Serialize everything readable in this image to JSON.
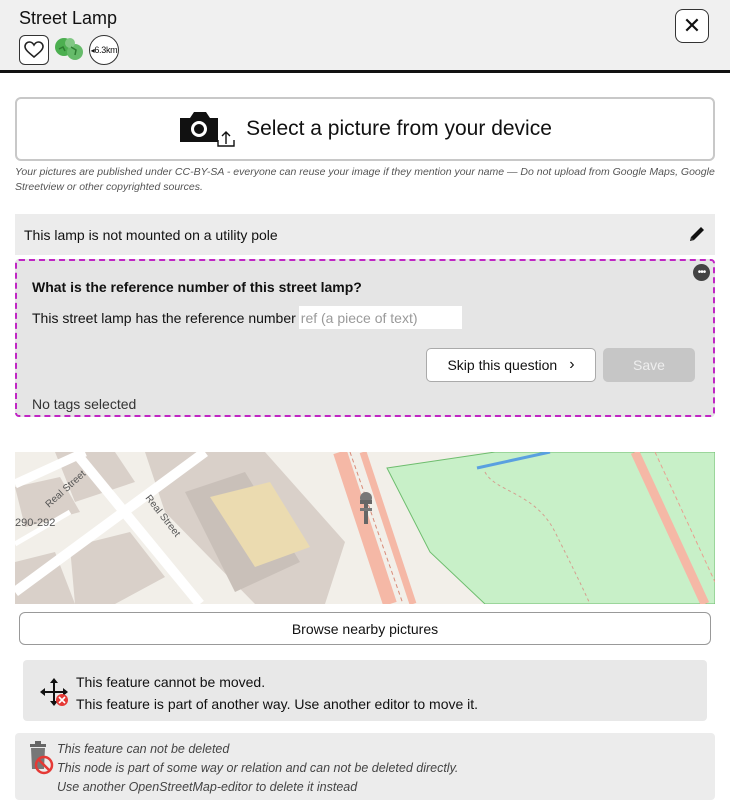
{
  "header": {
    "title": "Street Lamp",
    "distance": "6.3km",
    "close_symbol": "✕"
  },
  "upload": {
    "label": "Select a picture from your device"
  },
  "license": {
    "text": "Your pictures are published under CC-BY-SA - everyone can reuse your image if they mention your name  —  Do not upload from Google Maps, Google Streetview or other copyrighted sources."
  },
  "tag_row": {
    "text": "This lamp is not mounted on a utility pole"
  },
  "question": {
    "title": "What is the reference number of this street lamp?",
    "prefix": "This street lamp has the reference number",
    "input_placeholder": "ref (a piece of text)",
    "input_value": "",
    "skip_label": "Skip this question",
    "skip_chevron": "›",
    "save_label": "Save",
    "status": "No tags selected",
    "more_symbol": "•••"
  },
  "map": {
    "street_labels": [
      "Real Street",
      "Real Street"
    ],
    "house_number": "290-292"
  },
  "browse": {
    "label": "Browse nearby pictures"
  },
  "move": {
    "line1": "This feature cannot be moved.",
    "line2": "This feature is part of another way. Use another editor to move it."
  },
  "delete": {
    "line1": "This feature can not be deleted",
    "line2": "This node is part of some way or relation and can not be deleted directly.",
    "line3": "Use another OpenStreetMap-editor to delete it instead"
  },
  "colors": {
    "question_border": "#c026c4",
    "park": "#c8f0c8",
    "road": "#f5b8a6",
    "building": "#d9d0c9",
    "landuse": "#ebdbb0"
  }
}
